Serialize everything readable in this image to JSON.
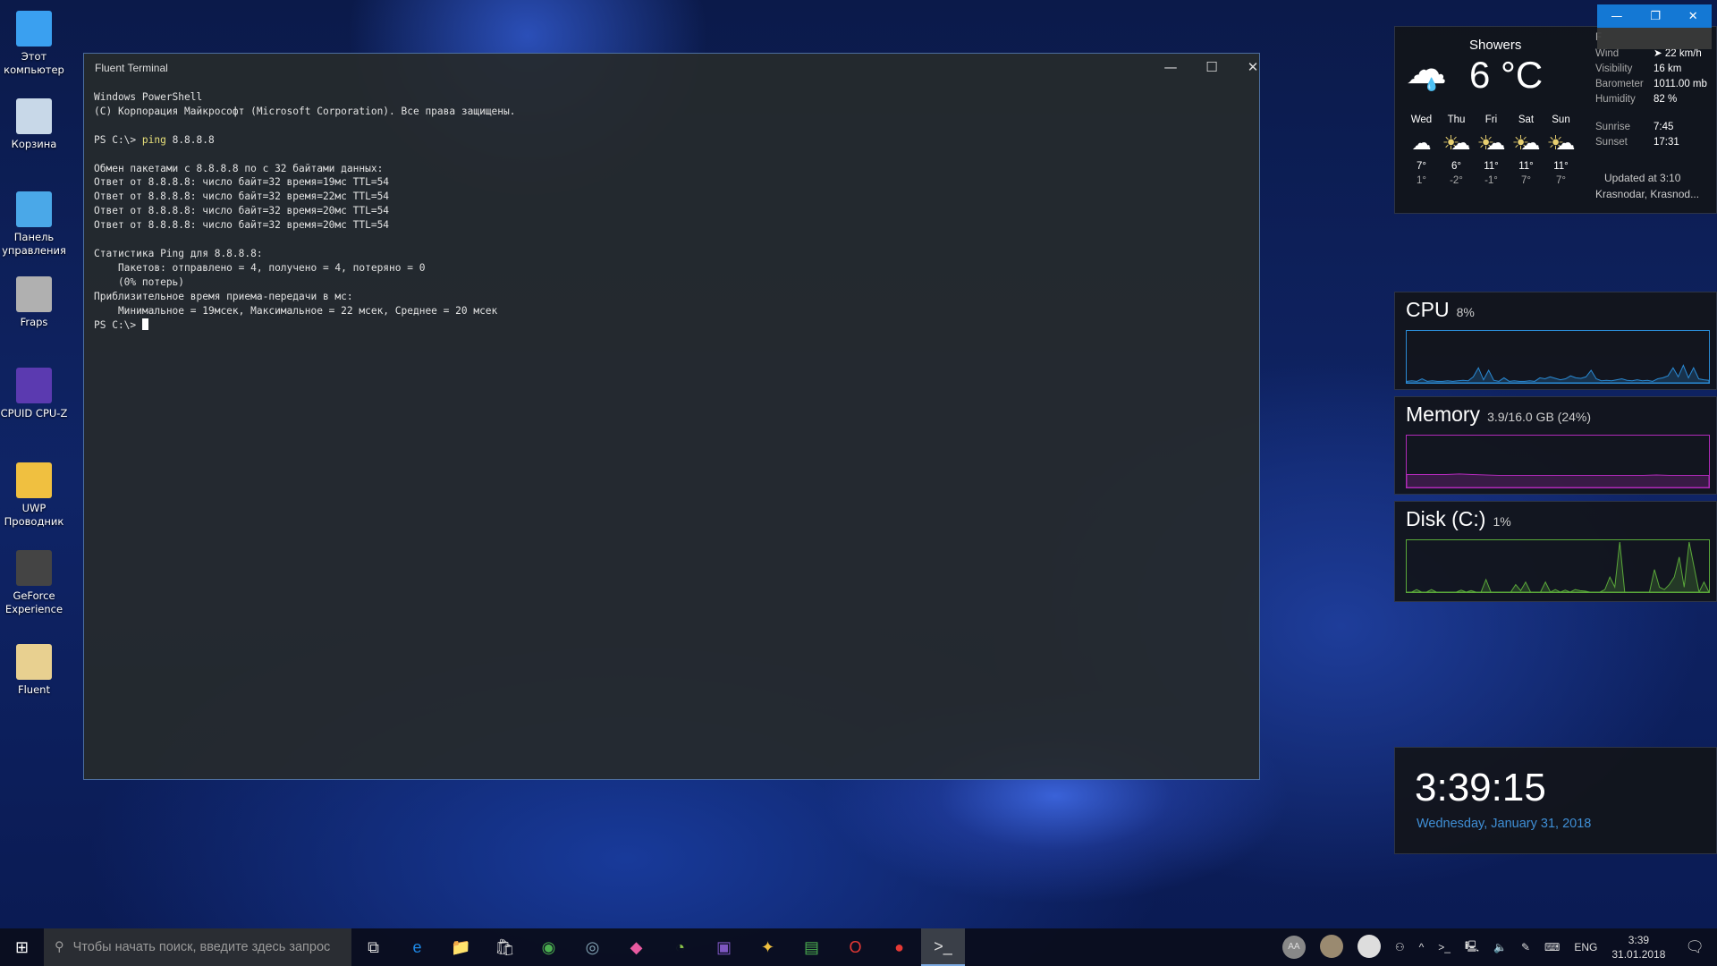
{
  "desktop_icons": [
    {
      "label": "Этот компьютер",
      "color": "#3aa0f0"
    },
    {
      "label": "Корзина",
      "color": "#c8d8e8"
    },
    {
      "label": "Панель управления",
      "color": "#4aa8e8"
    },
    {
      "label": "Fraps",
      "color": "#b0b0b0"
    },
    {
      "label": "CPUID CPU-Z",
      "color": "#5b3ab0"
    },
    {
      "label": "UWP Проводник",
      "color": "#f0c040"
    },
    {
      "label": "GeForce Experience",
      "color": "#444"
    },
    {
      "label": "Fluent",
      "color": "#e8d090"
    }
  ],
  "terminal": {
    "title": "Fluent Terminal",
    "lines": [
      "Windows PowerShell",
      "(C) Корпорация Майкрософт (Microsoft Corporation). Все права защищены.",
      "",
      "",
      "",
      "Обмен пакетами с 8.8.8.8 по с 32 байтами данных:",
      "Ответ от 8.8.8.8: число байт=32 время=19мс TTL=54",
      "Ответ от 8.8.8.8: число байт=32 время=22мс TTL=54",
      "Ответ от 8.8.8.8: число байт=32 время=20мс TTL=54",
      "Ответ от 8.8.8.8: число байт=32 время=20мс TTL=54",
      "",
      "Статистика Ping для 8.8.8.8:",
      "    Пакетов: отправлено = 4, получено = 4, потеряно = 0",
      "    (0% потерь)",
      "Приблизительное время приема-передачи в мс:",
      "    Минимальное = 19мсек, Максимальное = 22 мсек, Среднее = 20 мсек"
    ],
    "prompt": "PS C:\\> ",
    "command": "ping",
    "command_args": " 8.8.8.8"
  },
  "weather": {
    "condition": "Showers",
    "temp": "6 °C",
    "top_label": "F",
    "details": [
      [
        "Wind",
        "➤ 22 km/h"
      ],
      [
        "Visibility",
        "16 km"
      ],
      [
        "Barometer",
        "1011.00 mb"
      ],
      [
        "Humidity",
        "82 %"
      ]
    ],
    "sun": [
      [
        "Sunrise",
        "7:45"
      ],
      [
        "Sunset",
        "17:31"
      ]
    ],
    "updated": "Updated at 3:10",
    "location": "Krasnodar, Krasnod...",
    "forecast": [
      {
        "day": "Wed",
        "hi": "7°",
        "lo": "1°",
        "icon": "rain-cloud"
      },
      {
        "day": "Thu",
        "hi": "6°",
        "lo": "-2°",
        "icon": "partly-cloudy"
      },
      {
        "day": "Fri",
        "hi": "11°",
        "lo": "-1°",
        "icon": "partly-cloudy"
      },
      {
        "day": "Sat",
        "hi": "11°",
        "lo": "7°",
        "icon": "partly-cloudy"
      },
      {
        "day": "Sun",
        "hi": "11°",
        "lo": "7°",
        "icon": "partly-cloudy"
      }
    ]
  },
  "monitors": {
    "cpu": {
      "label": "CPU",
      "value": "8%",
      "color": "#2a8ad4",
      "samples": [
        3,
        4,
        3,
        8,
        3,
        4,
        3,
        3,
        4,
        3,
        4,
        5,
        4,
        12,
        30,
        6,
        25,
        5,
        3,
        10,
        3,
        4,
        3,
        3,
        4,
        3,
        10,
        8,
        12,
        9,
        6,
        8,
        14,
        10,
        9,
        12,
        25,
        8,
        4,
        5,
        4,
        6,
        8,
        5,
        4,
        6,
        4,
        5,
        3,
        8,
        10,
        14,
        30,
        12,
        35,
        10,
        30,
        8,
        6,
        5
      ]
    },
    "memory": {
      "label": "Memory",
      "value": "3.9/16.0 GB (24%)",
      "color": "#b02ab8",
      "samples": [
        26,
        26,
        26,
        26,
        27,
        26,
        25,
        24,
        24,
        24,
        24,
        24,
        24,
        24,
        24,
        24,
        24,
        24,
        24,
        25,
        24,
        24,
        24,
        24
      ]
    },
    "disk": {
      "label": "Disk (C:)",
      "value": "1%",
      "color": "#5aa83a",
      "samples": [
        0,
        0,
        5,
        0,
        0,
        5,
        0,
        0,
        0,
        0,
        0,
        4,
        0,
        3,
        0,
        0,
        25,
        0,
        0,
        0,
        0,
        0,
        15,
        3,
        20,
        0,
        0,
        0,
        20,
        0,
        5,
        0,
        4,
        0,
        5,
        3,
        2,
        0,
        0,
        0,
        5,
        30,
        10,
        100,
        0,
        0,
        0,
        0,
        0,
        0,
        45,
        10,
        5,
        15,
        30,
        70,
        10,
        100,
        50,
        0,
        20,
        0
      ]
    }
  },
  "clock": {
    "time": "3:39:15",
    "date": "Wednesday, January 31, 2018"
  },
  "taskbar": {
    "search_placeholder": "Чтобы начать поиск, введите здесь запрос",
    "apps": [
      "task-view",
      "edge",
      "file-explorer",
      "store",
      "chrome",
      "steam",
      "paint3d",
      "speedometer",
      "cpuz",
      "fraps",
      "gpu",
      "opera",
      "recorder",
      "fluent-terminal"
    ],
    "tray": {
      "lang": "ENG",
      "time": "3:39",
      "date": "31.01.2018",
      "avatar_initials": "AA"
    }
  }
}
